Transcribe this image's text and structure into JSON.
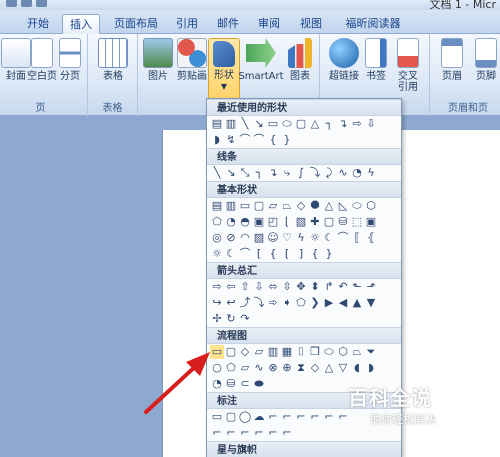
{
  "window": {
    "title": "文档 1 - Micr"
  },
  "tabs": [
    {
      "label": "开始"
    },
    {
      "label": "插入",
      "active": true
    },
    {
      "label": "页面布局"
    },
    {
      "label": "引用"
    },
    {
      "label": "邮件"
    },
    {
      "label": "审阅"
    },
    {
      "label": "视图"
    },
    {
      "label": "福昕阅读器"
    }
  ],
  "ribbon": {
    "groups": {
      "pages": {
        "label": "页",
        "buttons": [
          "封面",
          "空白页",
          "分页"
        ]
      },
      "tables": {
        "label": "表格",
        "buttons": [
          "表格"
        ]
      },
      "illustrations": {
        "buttons": [
          "图片",
          "剪贴画",
          "形状",
          "SmartArt",
          "图表"
        ]
      },
      "links": {
        "buttons": [
          "超链接",
          "书签",
          "交叉引用"
        ]
      },
      "header_footer": {
        "label": "页眉和页",
        "buttons": [
          "页眉",
          "页脚"
        ]
      }
    }
  },
  "shapes_menu": {
    "sections": [
      {
        "title": "最近使用的形状"
      },
      {
        "title": "线条"
      },
      {
        "title": "基本形状"
      },
      {
        "title": "箭头总汇"
      },
      {
        "title": "流程图"
      },
      {
        "title": "标注"
      },
      {
        "title": "星与旗帜"
      }
    ]
  },
  "watermark": {
    "main": "百科全说",
    "sub": "助你轻松解决"
  },
  "colors": {
    "accent": "#ffd36b",
    "annotation_arrow": "#d81e1e",
    "ribbon_text": "#1e395b"
  }
}
